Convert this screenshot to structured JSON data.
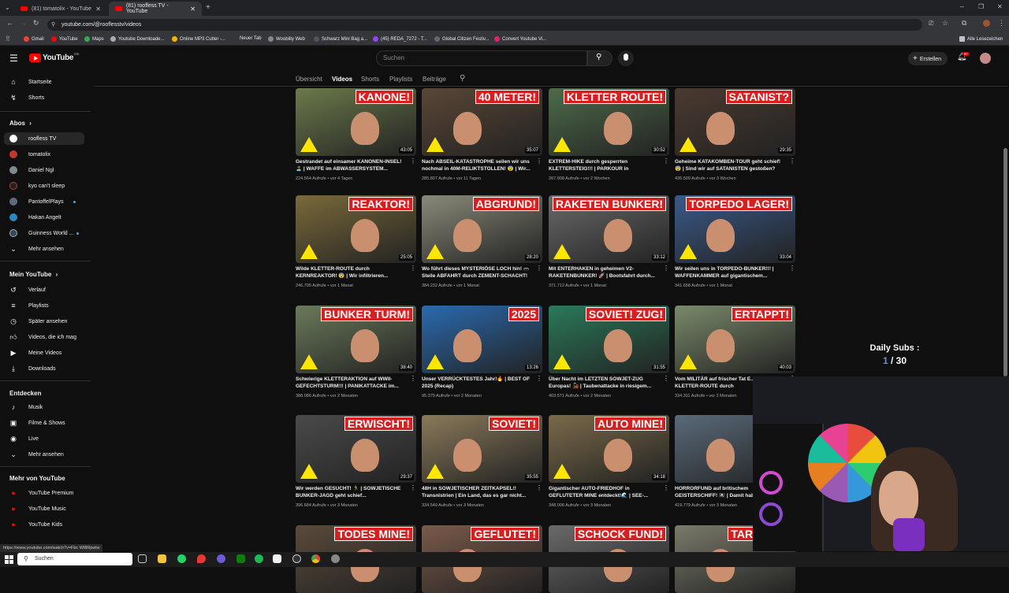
{
  "browser": {
    "tabs": [
      {
        "label": "(81) tomatolix - YouTube"
      },
      {
        "label": "(81) roofless TV - YouTube"
      }
    ],
    "url": "youtube.com/@rooflesstv/videos",
    "bookmarks": [
      "Gmail",
      "YouTube",
      "Maps",
      "Youtube Downloade...",
      "Online MP3 Cutter -...",
      "Neuer Tab",
      "Wooblity Web",
      "Schwarz Mini Bag a...",
      "(45) REDA_7272 - T...",
      "Global Citizen Festiv...",
      "Convert Youtube Vi..."
    ],
    "all_bookmarks": "Alle Lesezeichen",
    "status_url": "https://www.youtube.com/watch?v=Fbc W8lRpwlw"
  },
  "header": {
    "logo": "YouTube",
    "logo_suffix": "DE",
    "search_placeholder": "Suchen",
    "create_label": "Erstellen",
    "notif_badge": "9+"
  },
  "sidebar": {
    "main": [
      {
        "label": "Startseite",
        "icon": "home-icon"
      },
      {
        "label": "Shorts",
        "icon": "shorts-icon"
      }
    ],
    "abos_title": "Abos",
    "abos": [
      {
        "label": "roofless TV",
        "color": "#ffffff"
      },
      {
        "label": "tomatolix",
        "color": "#c0392b"
      },
      {
        "label": "Daniel Ngl",
        "color": "#7f8c8d"
      },
      {
        "label": "kyo can't sleep",
        "color": "#222222"
      },
      {
        "label": "PantoffelPlays",
        "color": "#5d6d7e"
      },
      {
        "label": "Hakan Angelt",
        "color": "#2e86c1"
      },
      {
        "label": "Guinness World ...",
        "color": "#34495e"
      }
    ],
    "abos_more": "Mehr ansehen",
    "you_title": "Mein YouTube",
    "you": [
      {
        "label": "Verlauf",
        "icon": "history-icon"
      },
      {
        "label": "Playlists",
        "icon": "playlist-icon"
      },
      {
        "label": "Später ansehen",
        "icon": "clock-icon"
      },
      {
        "label": "Videos, die ich mag",
        "icon": "thumbs-up-icon"
      },
      {
        "label": "Meine Videos",
        "icon": "video-icon"
      },
      {
        "label": "Downloads",
        "icon": "download-icon"
      }
    ],
    "explore_title": "Entdecken",
    "explore": [
      {
        "label": "Musik",
        "icon": "music-icon"
      },
      {
        "label": "Filme & Shows",
        "icon": "film-icon"
      },
      {
        "label": "Live",
        "icon": "live-icon"
      },
      {
        "label": "Mehr ansehen",
        "icon": "chevron-down-icon"
      }
    ],
    "more_title": "Mehr von YouTube",
    "more": [
      {
        "label": "YouTube Premium"
      },
      {
        "label": "YouTube Music"
      },
      {
        "label": "YouTube Kids"
      }
    ]
  },
  "channel_tabs": [
    "Übersicht",
    "Videos",
    "Shorts",
    "Playlists",
    "Beiträge"
  ],
  "videos": [
    {
      "thumb_word": "KANONE!",
      "duration": "43:05",
      "title": "Gestrandet auf einsamer KANONEN-INSEL! 🏝️ | WAFFE im ABWASSERSYSTEM...",
      "meta": "224.564 Aufrufe • vor 4 Tagen",
      "bg": "#6b7a4a"
    },
    {
      "thumb_word": "40 METER!",
      "duration": "35:07",
      "title": "Nach ABSEIL-KATASTROPHE seilen wir uns nochmal in 40M-RELIKTSTOLLEN! 😨 | Wir...",
      "meta": "285.807 Aufrufe • vor 11 Tagen",
      "bg": "#5a4636"
    },
    {
      "thumb_word": "KLETTER ROUTE!",
      "duration": "30:52",
      "title": "EXTREM-HIKE durch gesperrten KLETTERSTEIG!!! | PARKOUR in verlassener...",
      "meta": "267.908 Aufrufe • vor 2 Wochen",
      "bg": "#4d6b4a"
    },
    {
      "thumb_word": "SATANIST?",
      "duration": "29:35",
      "title": "Geheime KATAKOMBEN-TOUR geht schief! 😨 | Sind wir auf SATANISTEN gestoßen?",
      "meta": "435.509 Aufrufe • vor 3 Wochen",
      "bg": "#4a3a30"
    },
    {
      "thumb_word": "REAKTOR!",
      "duration": "25:05",
      "title": "Wilde KLETTER-ROUTE durch KERNREAKTOR! 😨 | Wir infiltrieren...",
      "meta": "246.705 Aufrufe • vor 1 Monat",
      "bg": "#7a6a3a"
    },
    {
      "thumb_word": "ABGRUND!",
      "duration": "28:20",
      "title": "Wo führt dieses MYSTERIÖSE LOCH hin! 🕳️ Steile ABFAHRT durch ZEMENT-SCHACHT!",
      "meta": "384.232 Aufrufe • vor 1 Monat",
      "bg": "#8a8a7a"
    },
    {
      "thumb_word": "RAKETEN BUNKER!",
      "duration": "33:12",
      "title": "Mit ENTERHAKEN in geheimen V2-RAKETENBUNKER! 🚀 | Bootsfahrt durch...",
      "meta": "371.712 Aufrufe • vor 1 Monat",
      "bg": "#6a6a6a"
    },
    {
      "thumb_word": "TORPEDO LAGER!",
      "duration": "33:04",
      "title": "Wir seilen uns in TORPEDO-BUNKER!!! | WAFFENKAMMER auf gigantischem...",
      "meta": "341.658 Aufrufe • vor 1 Monat",
      "bg": "#3a5a8a"
    },
    {
      "thumb_word": "BUNKER TURM!",
      "duration": "38:40",
      "title": "Schwierige KLETTERAKTION auf WWII-GEFECHTSTURM!!! | PANIKATTACKE im...",
      "meta": "388.086 Aufrufe • vor 2 Monaten",
      "bg": "#6a7a5a"
    },
    {
      "thumb_word": "2025",
      "duration": "13:26",
      "title": "Unser VERRÜCKTESTES Jahr!🔥 | BEST OF 2025 (Recap)",
      "meta": "95.379 Aufrufe • vor 2 Monaten",
      "bg": "#2a6ab0"
    },
    {
      "thumb_word": "SOVIET! ZUG!",
      "duration": "31:55",
      "title": "Über Nacht im LETZTEN SOWJET-ZUG Europas! 🚂 | Taubenattacke in riesigem...",
      "meta": "403.571 Aufrufe • vor 2 Monaten",
      "bg": "#2a7a5a"
    },
    {
      "thumb_word": "ERTAPPT!",
      "duration": "40:03",
      "title": "Vom MILITÄR auf frischer Tat E... ||Wilde KLETTER-ROUTE durch",
      "meta": "334.311 Aufrufe • vor 2 Monaten",
      "bg": "#7a8a6a"
    },
    {
      "thumb_word": "ERWISCHT!",
      "duration": "29:37",
      "title": "Wir werden GESUCHT! 🏃 | SOWJETISCHE BUNKER-JAGD geht schief...",
      "meta": "396.684 Aufrufe • vor 3 Monaten",
      "bg": "#4a4a4a"
    },
    {
      "thumb_word": "SOVIET!",
      "duration": "35:55",
      "title": "48H in SOWJETISCHER ZEITKAPSEL!! Transnistrien | Ein Land, das es gar nicht...",
      "meta": "334.549 Aufrufe • vor 3 Monaten",
      "bg": "#8a7a5a"
    },
    {
      "thumb_word": "AUTO MINE!",
      "duration": "34:18",
      "title": "Gigantischer AUTO-FRIEDHOF in GEFLUTETER MINE entdeckt!🌊 | SEE-...",
      "meta": "348.006 Aufrufe • vor 3 Monaten",
      "bg": "#7a6a4a"
    },
    {
      "thumb_word": "",
      "duration": "",
      "title": "HORRORFUND auf britischem GEISTERSCHIFF! 🏴‍☠️ | Damit hab...",
      "meta": "419.779 Aufrufe • vor 3 Monaten",
      "bg": "#5a6a7a"
    },
    {
      "thumb_word": "TODES MINE!",
      "duration": "",
      "title": "",
      "meta": "",
      "bg": "#5a4a3a"
    },
    {
      "thumb_word": "GEFLUTET!",
      "duration": "",
      "title": "",
      "meta": "",
      "bg": "#7a5a4a"
    },
    {
      "thumb_word": "SCHOCK FUND!",
      "duration": "",
      "title": "",
      "meta": "",
      "bg": "#6a6a6a"
    },
    {
      "thumb_word": "TARNUNG!",
      "duration": "",
      "title": "",
      "meta": "",
      "bg": "#7a7a6a"
    }
  ],
  "overlay": {
    "daily_title": "Daily Subs :",
    "daily_current": "1",
    "daily_sep": " / ",
    "daily_goal": "30"
  },
  "taskbar": {
    "search_label": "Suchen"
  }
}
